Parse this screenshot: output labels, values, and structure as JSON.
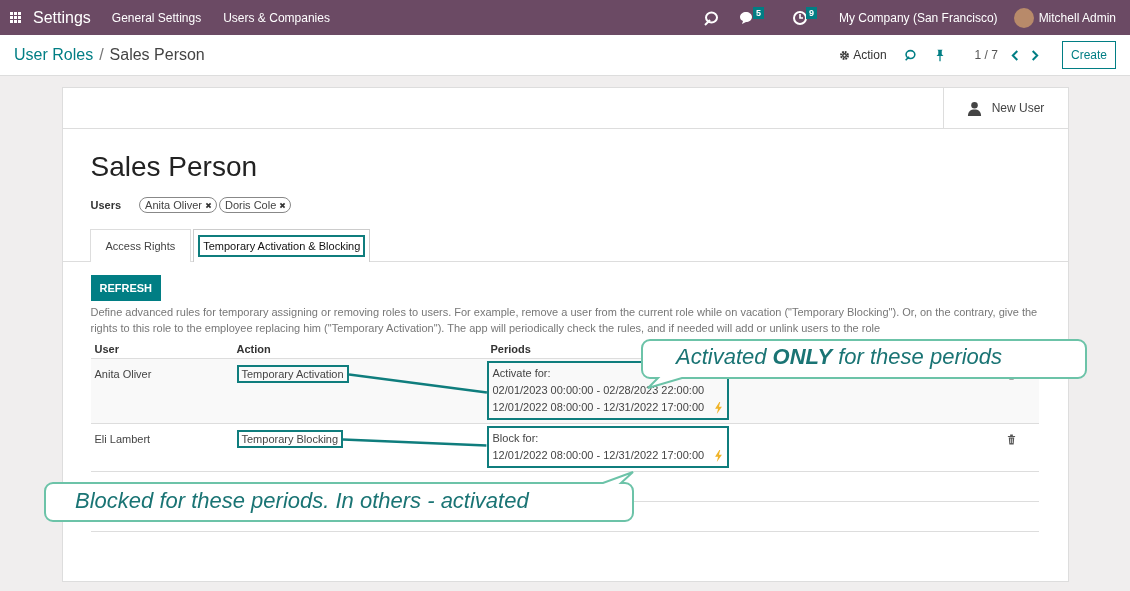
{
  "top_bar": {
    "app": "Settings",
    "menu": [
      "General Settings",
      "Users & Companies"
    ],
    "messages_count": "5",
    "activities_count": "9",
    "company": "My Company (San Francisco)",
    "user": "Mitchell Admin"
  },
  "breadcrumb": {
    "parent": "User Roles",
    "separator": "/",
    "current": "Sales Person"
  },
  "control_panel": {
    "action": "Action",
    "pager": "1 / 7",
    "create": "Create"
  },
  "form": {
    "new_user": "New User",
    "title": "Sales Person",
    "users_label": "Users",
    "users": [
      "Anita Oliver",
      "Doris Cole"
    ],
    "tabs": [
      {
        "label": "Access Rights",
        "selected": false,
        "highlighted": false
      },
      {
        "label": "Temporary Activation & Blocking",
        "selected": true,
        "highlighted": true
      }
    ],
    "refresh": "REFRESH",
    "description": "Define advanced rules for temporary assigning or removing roles to users. For example, remove a user from the current role while on vacation (\"Temporary Blocking\"). Or, on the contrary, give the rights to this role to the employee replacing him (\"Temporary Activation\"). The app will periodically check the rules, and if needed will add or unlink users to the role",
    "table": {
      "columns": [
        "User",
        "Action",
        "Periods"
      ],
      "rows": [
        {
          "user": "Anita Oliver",
          "action": "Temporary Activation",
          "highlighted": true,
          "periods_title": "Activate for:",
          "periods": [
            "02/01/2023 00:00:00 - 02/28/2023 22:00:00",
            "12/01/2022 08:00:00 - 12/31/2022 17:00:00"
          ]
        },
        {
          "user": "Eli Lambert",
          "action": "Temporary Blocking",
          "highlighted": true,
          "periods_title": "Block for:",
          "periods": [
            "12/01/2022 08:00:00 - 12/31/2022 17:00:00"
          ]
        }
      ]
    }
  },
  "callouts": [
    {
      "kind": "down",
      "text": "Activated **ONLY** for these periods"
    },
    {
      "kind": "up",
      "text": "Blocked for these periods. In others - activated"
    }
  ]
}
